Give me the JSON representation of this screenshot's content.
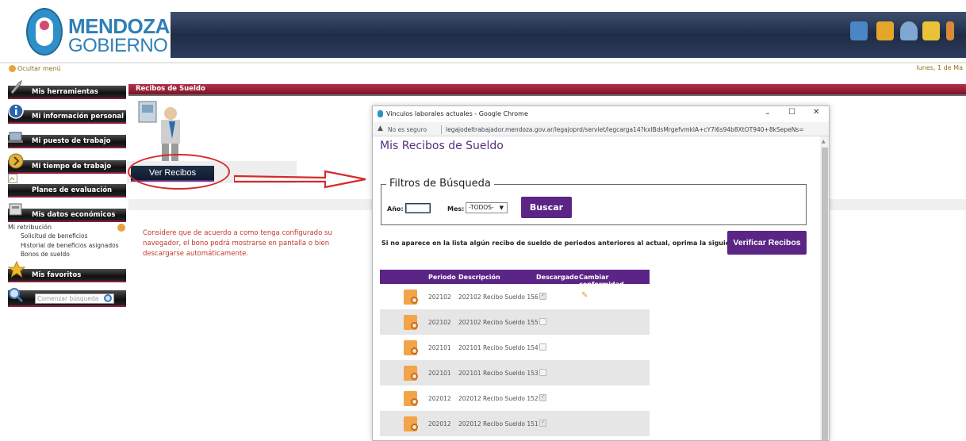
{
  "header": {
    "logo_line1": "MENDOZA",
    "logo_line2": "GOBIERNO",
    "icons": [
      "network-icon",
      "home-icon",
      "user-icon",
      "favorite-star-icon",
      "exit-icon"
    ],
    "brand_color": "#2f7fb6"
  },
  "topbar": {
    "hide_menu": "Ocultar menú",
    "date": "lunes, 1 de Ma"
  },
  "sidebar": {
    "items": [
      {
        "label": "Mis herramientas",
        "icon": "wrench-icon"
      },
      {
        "label": "Mi información personal",
        "icon": "info-icon"
      },
      {
        "label": "Mi puesto de trabajo",
        "icon": "laptop-icon"
      },
      {
        "label": "Mi tiempo de trabajo",
        "icon": "chevron-right-icon"
      },
      {
        "label": "Planes de evaluación",
        "icon": "broken-image-icon"
      },
      {
        "label": "Mis datos económicos",
        "icon": "money-icon"
      },
      {
        "label": "Mis favoritos",
        "icon": "star-icon"
      }
    ],
    "submenu_title": "Mi retribución",
    "submenu": [
      "Solicitud de beneficios",
      "Historial de beneficios asignados",
      "Bonos de sueldo"
    ],
    "search_placeholder": "Comenzar búsqueda"
  },
  "main": {
    "section_title": "Recibos de Sueldo",
    "ver_recibos": "Ver Recibos",
    "notice": "Considere que de acuerdo a como tenga configurado su navegador, el bono podrá mostrarse en pantalla o bien descargarse automáticamente."
  },
  "popup": {
    "window_title": "Vinculos laborales actuales - Google Chrome",
    "not_secure": "No es seguro",
    "url": "legajodeltrabajador.mendoza.gov.ar/legajoprd/servlet/legcarga14?kxlBdsMrgefvmklA+cY7l6s94b8XtOT940+8kSepeNs=",
    "controls": {
      "minimize": "–",
      "maximize": "☐",
      "close": "✕"
    },
    "page_title": "Mis Recibos de Sueldo",
    "filters_legend": "Filtros de Búsqueda",
    "year_label": "Año:",
    "year_value": "",
    "month_label": "Mes:",
    "month_value": "-TODOS-",
    "search_button": "Buscar",
    "info_text": "Si no aparece en la lista algún recibo de sueldo de periodos anteriores al actual, oprima la siguiente opción:",
    "verify_button": "Verificar Recibos",
    "accent_color": "#5b2585",
    "table": {
      "headers": [
        "Periodo",
        "Descripción",
        "Descargado",
        "Cambiar conformidad"
      ],
      "rows": [
        {
          "periodo": "202102",
          "descripcion": "202102 Recibo Sueldo 156",
          "descargado": true,
          "editable": true
        },
        {
          "periodo": "202102",
          "descripcion": "202102 Recibo Sueldo 155",
          "descargado": false,
          "editable": false
        },
        {
          "periodo": "202101",
          "descripcion": "202101 Recibo Sueldo 154",
          "descargado": false,
          "editable": false
        },
        {
          "periodo": "202101",
          "descripcion": "202101 Recibo Sueldo 153",
          "descargado": false,
          "editable": false
        },
        {
          "periodo": "202012",
          "descripcion": "202012 Recibo Sueldo 152",
          "descargado": true,
          "editable": false
        },
        {
          "periodo": "202012",
          "descripcion": "202012 Recibo Sueldo 151",
          "descargado": true,
          "editable": false
        }
      ]
    }
  }
}
